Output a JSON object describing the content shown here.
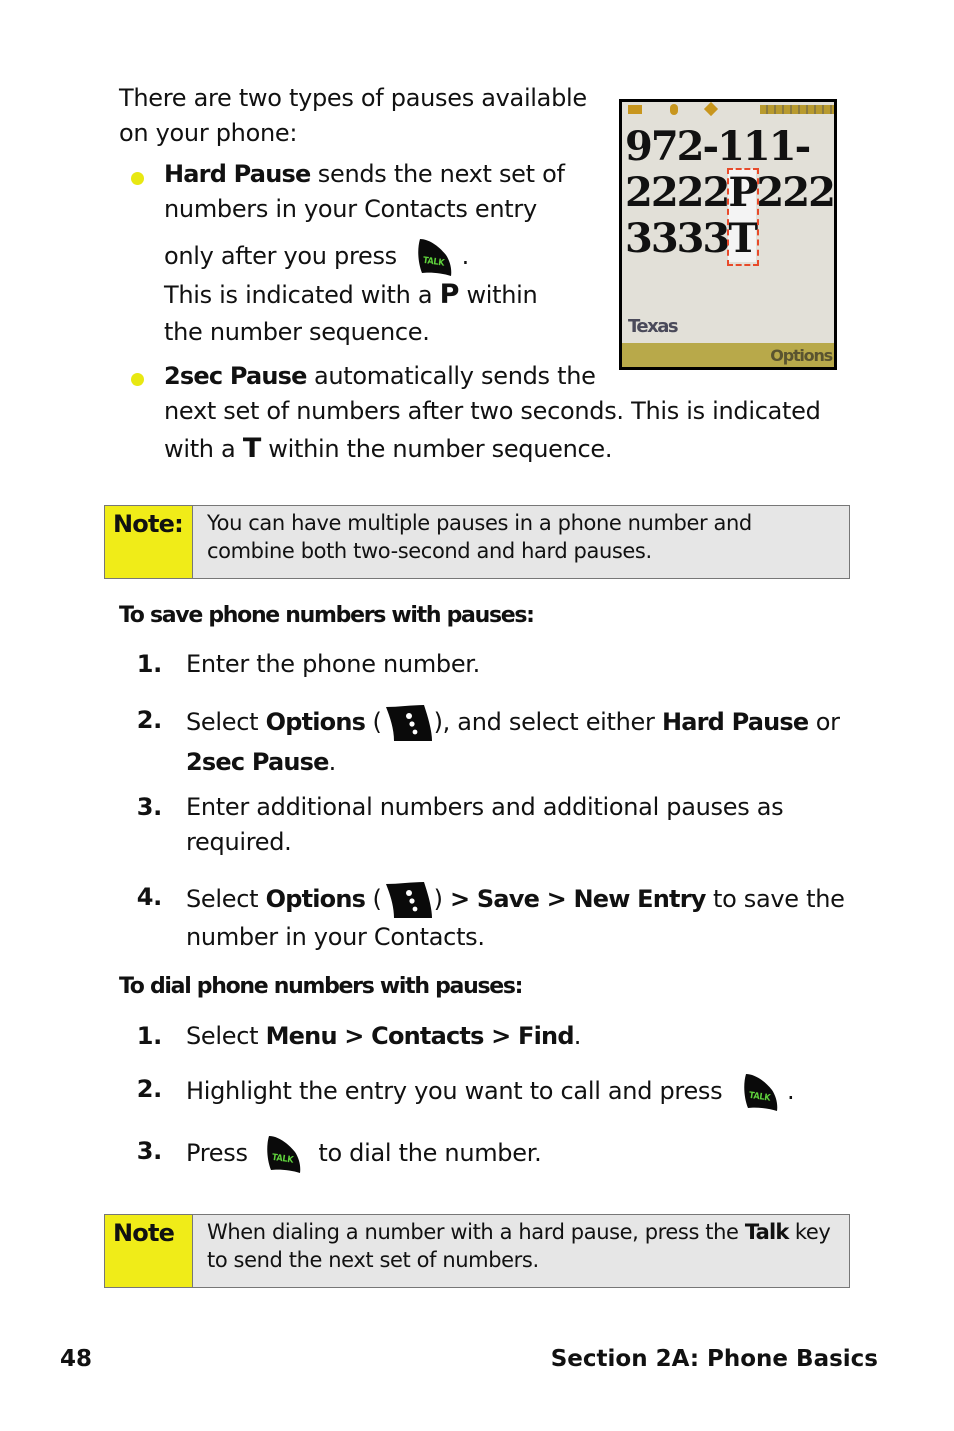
{
  "intro": "There are two types of pauses available on your phone:",
  "intro_lines": [
    "There are two types of pauses available",
    "on your phone:"
  ],
  "bullets": [
    {
      "term": "Hard Pause",
      "lines": [
        "sends the next set of",
        "numbers in your Contacts entry",
        "only after you press",
        ".",
        "This is indicated with a",
        "P",
        "within",
        "the number sequence."
      ]
    },
    {
      "term": "2sec Pause",
      "lines": [
        "automatically sends the",
        "next set of numbers after two seconds. This is indicated",
        "with a",
        "T",
        "within the number sequence."
      ]
    }
  ],
  "phone_screen": {
    "line1": "972-111-",
    "line2_a": "2222",
    "line2_p": "P",
    "line2_b": "222",
    "line3_a": "3333",
    "line3_t": "T",
    "label": "Texas",
    "softkey": "Options",
    "colors": {
      "screen": "#e2e0d8",
      "softbar": "#b8a94a",
      "highlight": "#e84a2a",
      "status_icons": "#c8961e"
    }
  },
  "note1": {
    "label": "Note:",
    "lines": [
      "You can have multiple pauses in a phone number and",
      "combine both two-second and hard pauses."
    ]
  },
  "save_section": {
    "heading": "To save phone numbers with pauses:",
    "steps": [
      {
        "num": "1.",
        "text": "Enter the phone number."
      },
      {
        "num": "2.",
        "a": "Select",
        "b": "Options",
        "c": "(",
        "d": "), and select either",
        "e": "Hard Pause",
        "f": "or",
        "g": "2sec Pause",
        "h": "."
      },
      {
        "num": "3.",
        "lines": [
          "Enter additional numbers and additional pauses as",
          "required."
        ]
      },
      {
        "num": "4.",
        "a": "Select",
        "b": "Options",
        "c": "(",
        "d": ")",
        "e": "> Save > New Entry",
        "f": "to save the",
        "g": "number in your Contacts."
      }
    ]
  },
  "dial_section": {
    "heading": "To dial phone numbers with pauses:",
    "steps": [
      {
        "num": "1.",
        "a": "Select",
        "b": "Menu > Contacts > Find",
        "c": "."
      },
      {
        "num": "2.",
        "a": "Highlight the entry you want to call and press",
        "b": "."
      },
      {
        "num": "3.",
        "a": "Press",
        "b": "to dial the number."
      }
    ]
  },
  "note2": {
    "label": "Note",
    "a": "When dialing a number with a hard pause, press the",
    "b": "Talk",
    "c": "key",
    "d": "to send the next set of numbers."
  },
  "icons": {
    "talk_key_label": "TALK",
    "talk_text_color": "#5fd23c",
    "bullet_color": "#e8e812",
    "note_label_bg": "#f0ec18",
    "note_bg": "#e6e6e6"
  },
  "footer": {
    "page_number": "48",
    "section": "Section 2A: Phone Basics"
  }
}
